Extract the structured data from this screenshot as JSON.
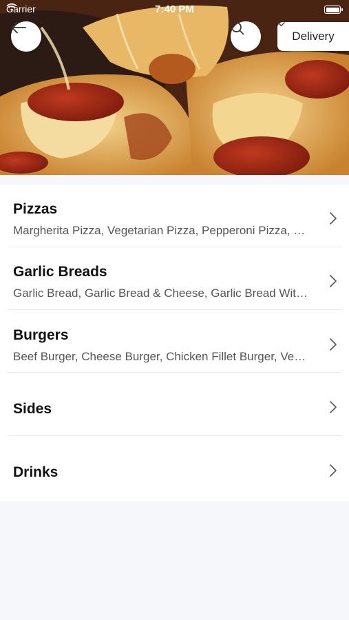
{
  "status_bar": {
    "carrier": "Carrier",
    "time": "7:40 PM"
  },
  "header": {
    "delivery_label": "Delivery"
  },
  "icons": {
    "back": "arrow-left-icon",
    "search": "search-icon",
    "dropdown": "chevron-down-icon",
    "row": "chevron-right-icon"
  },
  "categories": [
    {
      "title": "Pizzas",
      "subtitle": "Margherita Pizza, Vegetarian Pizza, Pepperoni Pizza, Hawaiian Pizza"
    },
    {
      "title": "Garlic Breads",
      "subtitle": "Garlic Bread, Garlic Bread & Cheese, Garlic Bread With Cheese & Bacon"
    },
    {
      "title": "Burgers",
      "subtitle": "Beef Burger, Cheese Burger, Chicken Fillet Burger, Vegetarian Burger"
    },
    {
      "title": "Sides",
      "subtitle": ""
    },
    {
      "title": "Drinks",
      "subtitle": ""
    }
  ]
}
